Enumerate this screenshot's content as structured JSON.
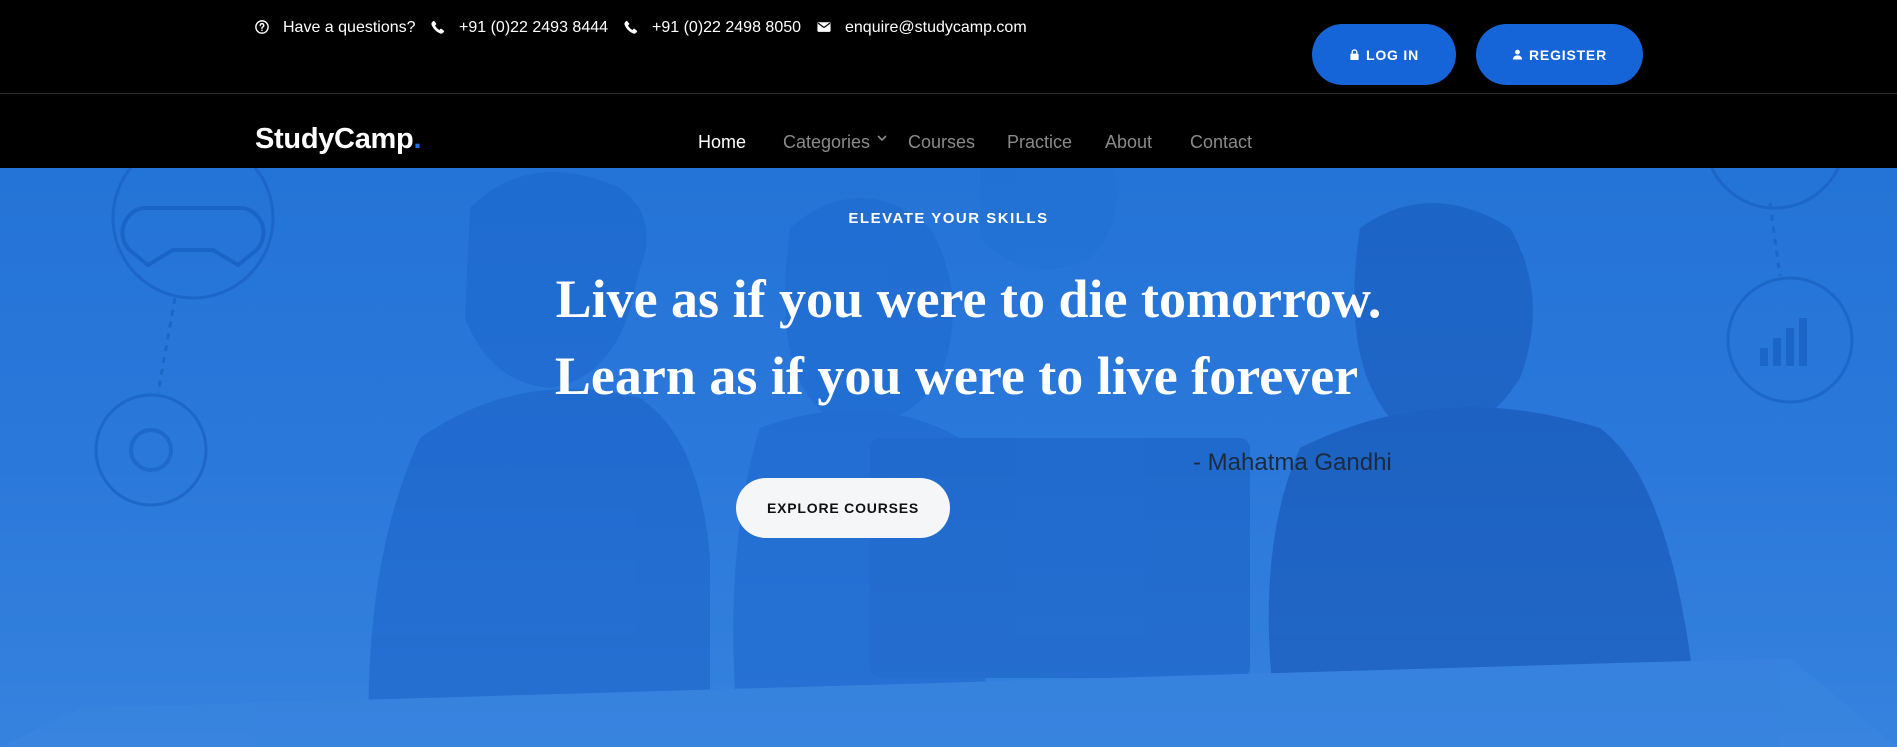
{
  "topbar": {
    "question_text": "Have a questions?",
    "phone_1": "+91 (0)22 2493 8444",
    "phone_2": "+91 (0)22 2498 8050",
    "email": "enquire@studycamp.com",
    "login_label": "LOG IN",
    "register_label": "REGISTER"
  },
  "navbar": {
    "logo_text": "StudyCamp",
    "logo_dot": ".",
    "items": [
      {
        "label": "Home",
        "active": true
      },
      {
        "label": "Categories",
        "has_dropdown": true
      },
      {
        "label": "Courses"
      },
      {
        "label": "Practice"
      },
      {
        "label": "About"
      },
      {
        "label": "Contact"
      }
    ]
  },
  "hero": {
    "eyebrow": "ELEVATE YOUR SKILLS",
    "quote_line_1": "Live as if you were to die tomorrow.",
    "quote_line_2": "Learn as if you were to live forever",
    "author": "- Mahatma Gandhi",
    "cta_label": "EXPLORE COURSES"
  },
  "colors": {
    "accent": "#1565d8",
    "hero_bg": "#2a78da",
    "topbar_bg": "#000000",
    "nav_active": "#ffffff",
    "nav_inactive": "#8a8a8a"
  },
  "icons": {
    "question": "question-circle-icon",
    "phone": "phone-icon",
    "email": "envelope-icon",
    "login": "lock-icon",
    "register": "user-icon",
    "dropdown": "chevron-down-icon"
  }
}
